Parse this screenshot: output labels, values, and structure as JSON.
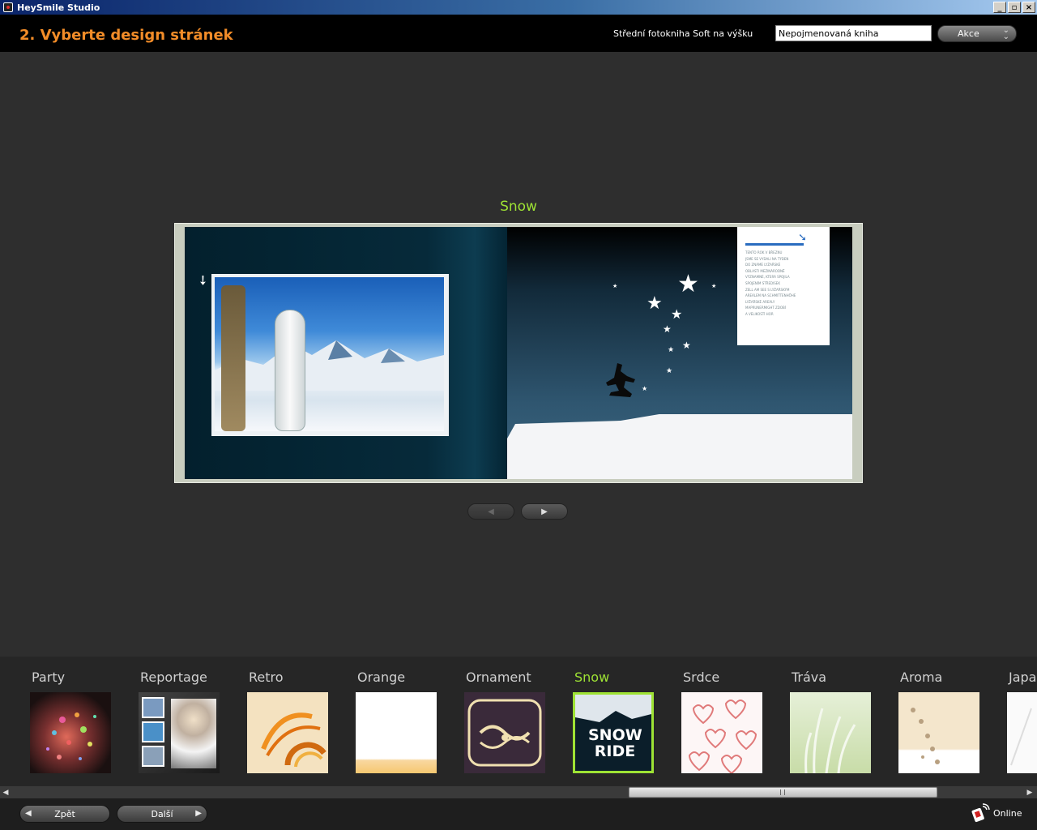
{
  "window": {
    "title": "HeySmile Studio",
    "buttons": [
      "_",
      "▫",
      "×"
    ]
  },
  "header": {
    "heading": "2. Vyberte design stránek",
    "product": "Střední fotokniha Soft na výšku",
    "book_name": "Nepojmenovaná kniha",
    "actions_label": "Akce"
  },
  "preview": {
    "design_name": "Snow",
    "textbox_lines": [
      "TENTO ROK V BŘEZNU",
      "JSME SE VYDALI NA TÝDEN",
      "DO ZNÁMÉ LYŽAŘSKÉ",
      "OBLASTI MEZINÁRODNĚ",
      "VÝZNAMNÉ, KTERÁ SPOJILA",
      "SPOJENÍM STŘEDISEK",
      "ZELL AM SEE S LYŽAŘSKÝM",
      "AREÁLEM NA SCHMITTENHÖHE",
      "LYŽAŘSKÉ AREÁLY",
      "MAPRUNERMIGHT ZDOBÍ",
      "A VELIKOSTÍ HOR"
    ]
  },
  "themes": [
    {
      "name": "Party",
      "selected": false
    },
    {
      "name": "Reportage",
      "selected": false
    },
    {
      "name": "Retro",
      "selected": false
    },
    {
      "name": "Orange",
      "selected": false
    },
    {
      "name": "Ornament",
      "selected": false
    },
    {
      "name": "Snow",
      "selected": true,
      "thumb_text": "SNOW RIDE"
    },
    {
      "name": "Srdce",
      "selected": false
    },
    {
      "name": "Tráva",
      "selected": false
    },
    {
      "name": "Aroma",
      "selected": false
    },
    {
      "name": "Japa",
      "selected": false
    }
  ],
  "footer": {
    "back_label": "Zpět",
    "next_label": "Další",
    "online_label": "Online"
  },
  "colors": {
    "accent_orange": "#f28c28",
    "accent_green": "#9ee234"
  }
}
